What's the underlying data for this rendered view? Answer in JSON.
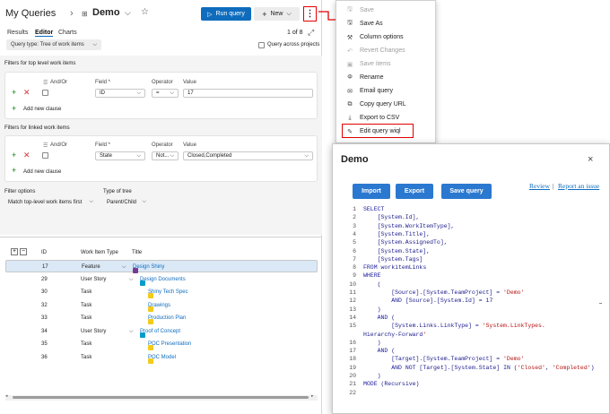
{
  "header": {
    "breadcrumb": "My Queries",
    "query_name": "Demo",
    "run_query": "Run query",
    "new_label": "New",
    "more": "⋮"
  },
  "tabs": [
    {
      "label": "Results"
    },
    {
      "label": "Editor"
    },
    {
      "label": "Charts"
    }
  ],
  "paging": "1 of 8",
  "query_type": "Query type: Tree of work items",
  "query_across": "Query across projects",
  "top_filters": {
    "title": "Filters for top level work items",
    "col_andor": "And/Or",
    "col_field": "Field *",
    "col_operator": "Operator",
    "col_value": "Value",
    "field": "ID",
    "operator": "=",
    "value": "17",
    "add_clause": "Add new clause"
  },
  "linked_filters": {
    "title": "Filters for linked work items",
    "col_andor": "And/Or",
    "col_field": "Field *",
    "col_operator": "Operator",
    "col_value": "Value",
    "field": "State",
    "operator": "Not...",
    "value": "Closed,Completed",
    "add_clause": "Add new clause"
  },
  "filter_options": {
    "label": "Filter options",
    "value": "Match top-level work items first"
  },
  "tree_type": {
    "label": "Type of tree",
    "value": "Parent/Child"
  },
  "results": {
    "headers": {
      "id": "ID",
      "type": "Work Item Type",
      "title": "Title"
    },
    "rows": [
      {
        "id": "17",
        "type": "Feature",
        "title": "Design Shiny",
        "kind": "feature"
      },
      {
        "id": "29",
        "type": "User Story",
        "title": "Design Documents",
        "kind": "story"
      },
      {
        "id": "30",
        "type": "Task",
        "title": "Shiny Tech Spec",
        "kind": "task"
      },
      {
        "id": "32",
        "type": "Task",
        "title": "Drawings",
        "kind": "task"
      },
      {
        "id": "33",
        "type": "Task",
        "title": "Production Plan",
        "kind": "task"
      },
      {
        "id": "34",
        "type": "User Story",
        "title": "Proof of Concept",
        "kind": "story"
      },
      {
        "id": "35",
        "type": "Task",
        "title": "POC Presentation",
        "kind": "task"
      },
      {
        "id": "36",
        "type": "Task",
        "title": "POC Model",
        "kind": "task"
      }
    ]
  },
  "menu": {
    "items": [
      {
        "label": "Save",
        "icon": "save-icon",
        "disabled": true
      },
      {
        "label": "Save As",
        "icon": "save-as-icon",
        "disabled": false
      },
      {
        "label": "Column options",
        "icon": "wrench-icon",
        "disabled": false
      },
      {
        "label": "Revert Changes",
        "icon": "undo-icon",
        "disabled": true
      },
      {
        "label": "Save items",
        "icon": "save-items-icon",
        "disabled": true
      },
      {
        "label": "Rename",
        "icon": "rename-icon",
        "disabled": false
      },
      {
        "label": "Email query",
        "icon": "mail-icon",
        "disabled": false
      },
      {
        "label": "Copy query URL",
        "icon": "copy-icon",
        "disabled": false
      },
      {
        "label": "Export to CSV",
        "icon": "download-icon",
        "disabled": false
      },
      {
        "label": "Edit query wiql",
        "icon": "edit-icon",
        "disabled": false
      }
    ]
  },
  "dialog": {
    "title": "Demo",
    "close": "×",
    "import": "Import",
    "export": "Export",
    "save_query": "Save query",
    "review": "Review",
    "separator": "|",
    "report": "Report an issue",
    "lines": [
      {
        "n": "1",
        "text": "SELECT"
      },
      {
        "n": "2",
        "text": "    [System.Id],"
      },
      {
        "n": "3",
        "text": "    [System.WorkItemType],"
      },
      {
        "n": "4",
        "text": "    [System.Title],"
      },
      {
        "n": "5",
        "text": "    [System.AssignedTo],"
      },
      {
        "n": "6",
        "text": "    [System.State],"
      },
      {
        "n": "7",
        "text": "    [System.Tags]"
      },
      {
        "n": "8",
        "text": "FROM workitemLinks"
      },
      {
        "n": "9",
        "text": "WHERE"
      },
      {
        "n": "10",
        "text": "    ("
      },
      {
        "n": "11",
        "text": "        [Source].[System.TeamProject] = 'Demo'"
      },
      {
        "n": "12",
        "text": "        AND [Source].[System.Id] = 17"
      },
      {
        "n": "13",
        "text": "    )"
      },
      {
        "n": "14",
        "text": "    AND ("
      },
      {
        "n": "15",
        "text": "        [System.Links.LinkType] = 'System.LinkTypes."
      },
      {
        "n": "",
        "text": "Hierarchy-Forward'"
      },
      {
        "n": "16",
        "text": "    )"
      },
      {
        "n": "17",
        "text": "    AND ("
      },
      {
        "n": "18",
        "text": "        [Target].[System.TeamProject] = 'Demo'"
      },
      {
        "n": "19",
        "text": "        AND NOT [Target].[System.State] IN ('Closed', 'Completed')"
      },
      {
        "n": "20",
        "text": "    )"
      },
      {
        "n": "21",
        "text": "MODE (Recursive)"
      },
      {
        "n": "22",
        "text": ""
      }
    ]
  },
  "colors": {
    "accent": "#0f6cbd",
    "highlight": "#e00000",
    "feature": "#773b93",
    "story": "#009ccc",
    "task": "#f2cb1d"
  }
}
